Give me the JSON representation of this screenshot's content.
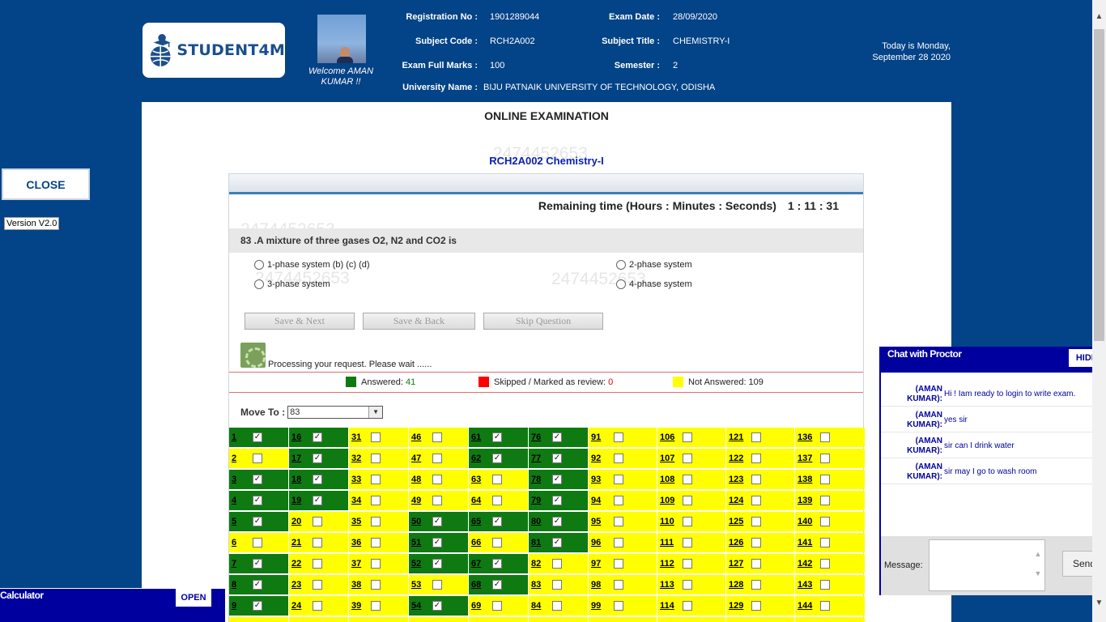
{
  "header": {
    "logo_text": "STUDENT4M",
    "welcome": "Welcome AMAN KUMAR !!",
    "registration_label": "Registration No :",
    "registration_value": "1901289044",
    "exam_date_label": "Exam Date :",
    "exam_date_value": "28/09/2020",
    "subject_code_label": "Subject Code :",
    "subject_code_value": "RCH2A002",
    "subject_title_label": "Subject Title :",
    "subject_title_value": "CHEMISTRY-I",
    "full_marks_label": "Exam Full Marks :",
    "full_marks_value": "100",
    "semester_label": "Semester :",
    "semester_value": "2",
    "university_label": "University Name :",
    "university_value": "BIJU PATNAIK UNIVERSITY OF TECHNOLOGY, ODISHA",
    "today_line1": "Today is Monday,",
    "today_line2": "September 28 2020"
  },
  "sidebar": {
    "close_label": "CLOSE",
    "version": "Version V2.0"
  },
  "calculator": {
    "title": "Calculator",
    "open_label": "OPEN"
  },
  "exam": {
    "page_title": "ONLINE EXAMINATION",
    "subject_heading": "RCH2A002 Chemistry-I",
    "watermark": "2474452653",
    "timer_label": "Remaining time (Hours : Minutes : Seconds)",
    "timer_value": "1 : 11 : 31",
    "question": "83 .A mixture of three gases O2, N2 and CO2 is",
    "options": [
      "1-phase system (b) (c) (d)",
      "2-phase system",
      "3-phase system",
      "4-phase system"
    ],
    "buttons": {
      "save_next": "Save & Next",
      "save_back": "Save & Back",
      "skip": "Skip Question"
    },
    "processing": "Processing your request. Please wait ......",
    "legend": {
      "answered_label": "Answered:",
      "answered_count": "41",
      "skipped_label": "Skipped / Marked as review:",
      "skipped_count": "0",
      "not_answered_label": "Not Answered:",
      "not_answered_count": "109"
    },
    "move_to_label": "Move To :",
    "move_to_value": "83",
    "colors": {
      "answered": "#0f7a12",
      "skipped": "#ff0000",
      "not_answered": "#ffff00"
    },
    "answered_questions": [
      1,
      3,
      4,
      5,
      7,
      8,
      9,
      16,
      17,
      18,
      19,
      50,
      51,
      52,
      54,
      61,
      62,
      65,
      67,
      68,
      76,
      77,
      78,
      79,
      80,
      81
    ]
  },
  "chat": {
    "title": "Chat with Proctor",
    "hide_label": "HIDE",
    "messages": [
      {
        "who": "(AMAN KUMAR):",
        "text": "Hi ! Iam ready to login to write exam."
      },
      {
        "who": "(AMAN KUMAR):",
        "text": "yes sir"
      },
      {
        "who": "(AMAN KUMAR):",
        "text": "sir can I drink water"
      },
      {
        "who": "(AMAN KUMAR):",
        "text": "sir may I go to wash room"
      }
    ],
    "message_label": "Message:",
    "send_label": "Send"
  }
}
